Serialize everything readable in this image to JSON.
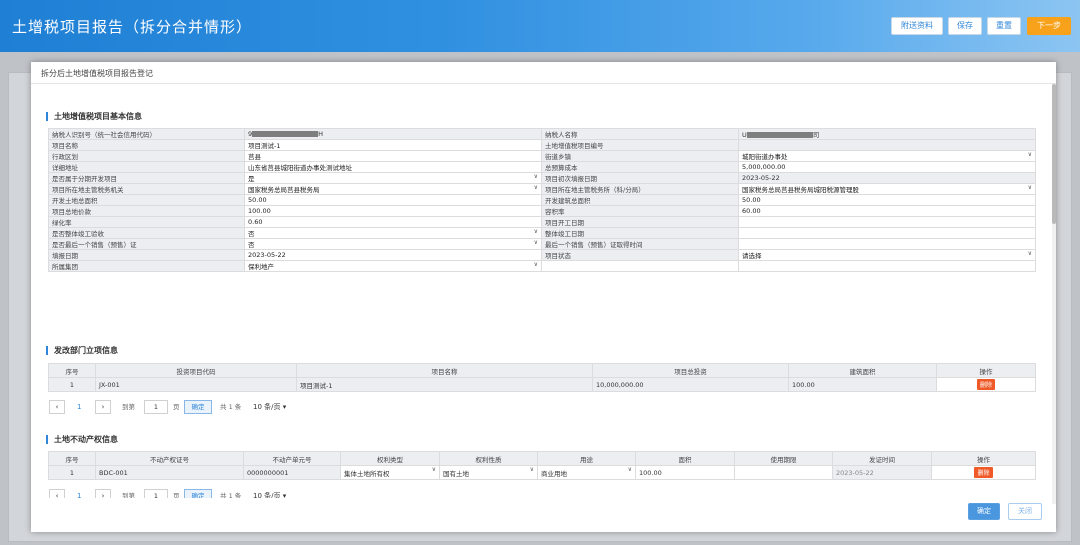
{
  "header": {
    "title": "土增税项目报告（拆分合并情形）",
    "buttons": {
      "attach": "附送资料",
      "save": "保存",
      "reset": "重置",
      "next": "下一步"
    }
  },
  "modal": {
    "title": "拆分后土地增值税项目报告登记",
    "basic_section": "土地增值税项目基本信息",
    "rows": [
      [
        "纳税人识别号（统一社会信用代码）",
        "9",
        "H",
        "纳税人名称",
        "U",
        "司"
      ],
      [
        "项目名称",
        "项目测试-1",
        "",
        "土地增值税项目编号",
        "",
        ""
      ],
      [
        "行政区划",
        "莒县",
        "",
        "街道乡镇",
        "城阳街道办事处",
        "v"
      ],
      [
        "详细地址",
        "山东省莒县城阳街道办事处测试地址",
        "",
        "总预算成本",
        "5,000,000.00",
        ""
      ],
      [
        "是否属于分期开发项目",
        "是",
        "v",
        "项目初次填报日期",
        "2023-05-22",
        ""
      ],
      [
        "项目所在地主管税务机关",
        "国家税务总局莒县税务局",
        "v",
        "项目所在地主管税务所（科/分局）",
        "国家税务总局莒县税务局城阳税源管理股",
        "v"
      ],
      [
        "开发土地总面积",
        "50.00",
        "",
        "开发建筑总面积",
        "50.00",
        ""
      ],
      [
        "项目总地价款",
        "100.00",
        "",
        "容积率",
        "60.00",
        ""
      ],
      [
        "绿化率",
        "0.60",
        "",
        "项目开工日期",
        "",
        ""
      ],
      [
        "是否整体竣工验收",
        "否",
        "v",
        "整体竣工日期",
        "",
        ""
      ],
      [
        "是否最后一个销售（预售）证",
        "否",
        "v",
        "最后一个销售（预售）证取得时间",
        "",
        ""
      ],
      [
        "填报日期",
        "2023-05-22",
        "",
        "项目状态",
        "请选择",
        "v"
      ],
      [
        "所属集团",
        "保利地产",
        "v",
        "",
        "",
        ""
      ]
    ],
    "approval_section": "发改部门立项信息",
    "approval_headers": [
      "序号",
      "投资项目代码",
      "项目名称",
      "项目总投资",
      "建筑面积",
      "操作"
    ],
    "approval_rows": [
      {
        "idx": "1",
        "code": "JX-001",
        "name": "项目测试-1",
        "invest": "10,000,000.00",
        "area": "100.00",
        "op": "删除"
      }
    ],
    "pager": {
      "prev": "‹",
      "page": "1",
      "next": "›",
      "goto": "到第",
      "page_input": "1",
      "page_unit": "页",
      "confirm": "确定",
      "total": "共 1 条",
      "size": "10 条/页"
    },
    "land_section": "土地不动产权信息",
    "land_headers": [
      "序号",
      "不动产权证号",
      "不动产单元号",
      "权利类型",
      "权利性质",
      "用途",
      "面积",
      "使用期限",
      "发证时间",
      "操作"
    ],
    "land_rows": [
      {
        "idx": "1",
        "cert": "BDC-001",
        "unit": "0000000001",
        "right_type": "集体土地所有权",
        "nature": "国有土地",
        "use": "商业用地",
        "area": "100.00",
        "term": "",
        "date": "2023-05-22",
        "op": "删除"
      }
    ],
    "footer": {
      "ok": "确定",
      "close": "关闭"
    }
  }
}
